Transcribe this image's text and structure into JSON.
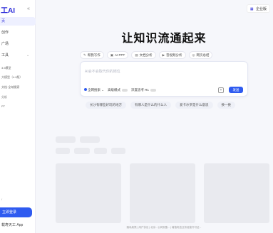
{
  "sidebar": {
    "brand": "工AI",
    "collapse_icon": "collapse-left-icon",
    "active_item": "页",
    "items": [
      "创作",
      "广场"
    ],
    "section_tools": "工具",
    "sub_items": [
      "3.5模型",
      "大模型（4.0版）",
      "文档·全域搜索",
      "分析",
      "PT"
    ],
    "mini_items": [
      "",
      "/"
    ],
    "login_label": "立即登录",
    "app_label": "载寿天工 App"
  },
  "topbar": {
    "badge_icon": "building-icon",
    "badge_label": "企业版"
  },
  "main": {
    "title": "让知识流通起来",
    "tabs": [
      {
        "icon": "doc-icon",
        "label": "帮我写作"
      },
      {
        "icon": "ppt-icon",
        "label": "AI PPT"
      },
      {
        "icon": "file-icon",
        "label": "文档分析"
      },
      {
        "icon": "video-icon",
        "label": "音视频分析"
      },
      {
        "icon": "web-icon",
        "label": "网页总结"
      }
    ],
    "input_placeholder": "AI会不会取代你的岗位",
    "option_search": "全网搜索",
    "option_advanced": "高级模式",
    "option_deep": "深度思考 R1",
    "send_label": "发送",
    "attach_icon": "attach-icon",
    "suggestions": [
      "长沙有哪些好玩的地方",
      "有哪人是什么的什么人",
      "爱卡尔罗是什么意思",
      "换一换"
    ]
  },
  "footer": "隐私政策 | 用户协议 | 北京...公网安备... | 增值电信业务经营许可证..."
}
